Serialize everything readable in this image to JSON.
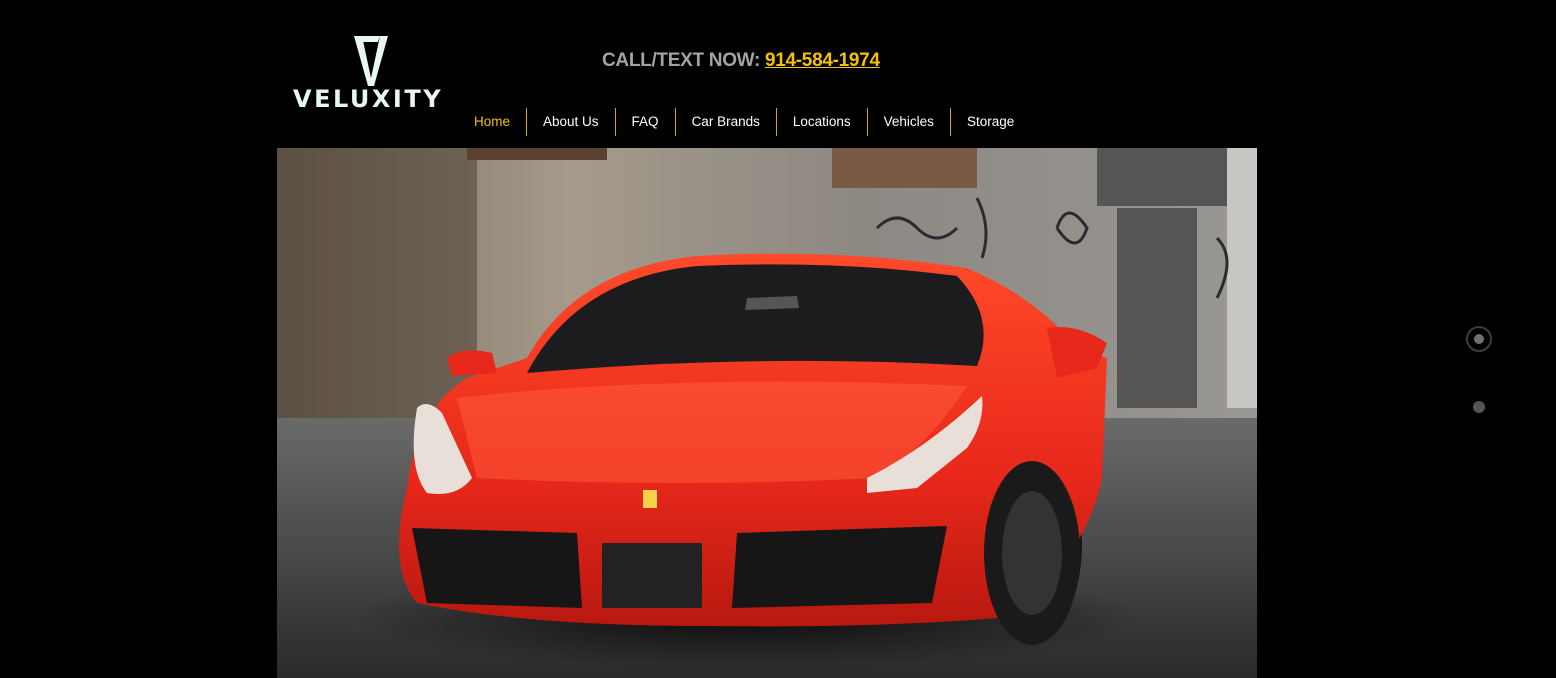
{
  "brand": {
    "name": "VELUXITY"
  },
  "header": {
    "call_prefix": "CALL/TEXT NOW:",
    "phone": "914-584-1974"
  },
  "nav": {
    "items": [
      {
        "label": "Home",
        "active": true
      },
      {
        "label": "About Us"
      },
      {
        "label": "FAQ"
      },
      {
        "label": "Car Brands"
      },
      {
        "label": "Locations"
      },
      {
        "label": "Vehicles"
      },
      {
        "label": "Storage"
      }
    ]
  },
  "slider": {
    "slide_count": 2,
    "current_slide": 1
  },
  "colors": {
    "accent": "#f2c200",
    "background": "#000000",
    "car": "#e8281a"
  }
}
